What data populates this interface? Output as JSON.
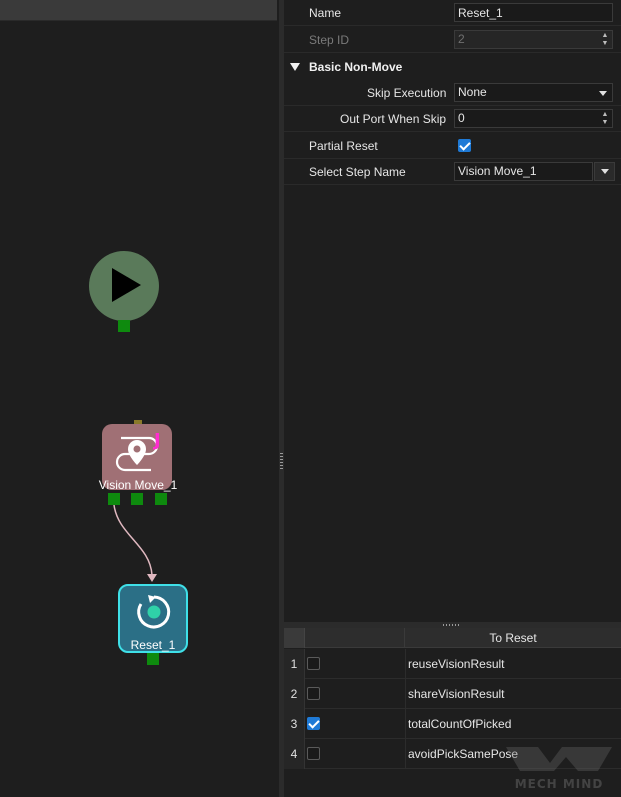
{
  "canvas": {
    "nodes": {
      "start": {
        "icon": "play-icon",
        "color": "#5a7a5a"
      },
      "vision_move": {
        "label": "Vision Move_1",
        "badge": "J",
        "icon": "vision-path-icon",
        "color": "#a07075"
      },
      "reset": {
        "label": "Reset_1",
        "icon": "reset-icon",
        "color": "#2b6f86",
        "selected": true
      }
    },
    "edges": [
      {
        "from": "Vision Move_1",
        "to": "Reset_1"
      }
    ]
  },
  "properties": {
    "name": {
      "label": "Name",
      "value": "Reset_1"
    },
    "step_id": {
      "label": "Step ID",
      "value": "2"
    },
    "section": {
      "title": "Basic Non-Move"
    },
    "skip_execution": {
      "label": "Skip Execution",
      "value": "None"
    },
    "out_port_when_skip": {
      "label": "Out Port When Skip",
      "value": "0"
    },
    "partial_reset": {
      "label": "Partial Reset",
      "checked": true
    },
    "select_step_name": {
      "label": "Select Step Name",
      "value": "Vision Move_1"
    }
  },
  "reset_table": {
    "header": "To Reset",
    "rows": [
      {
        "num": "1",
        "checked": false,
        "name": "reuseVisionResult"
      },
      {
        "num": "2",
        "checked": false,
        "name": "shareVisionResult"
      },
      {
        "num": "3",
        "checked": true,
        "name": "totalCountOfPicked"
      },
      {
        "num": "4",
        "checked": false,
        "name": "avoidPickSamePose"
      }
    ]
  },
  "watermark": {
    "text": "MECH MIND"
  },
  "colors": {
    "accent": "#1f7ad6",
    "port": "#0e8a0e",
    "selection": "#3fe0e8"
  }
}
